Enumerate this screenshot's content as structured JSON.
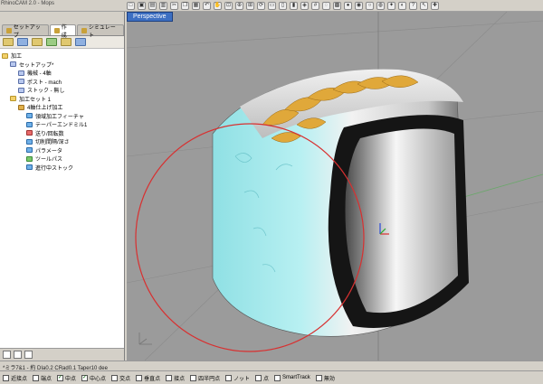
{
  "app": {
    "title": "RhinoCAM 2.0 - Mops"
  },
  "toolbar": {
    "buttons": [
      "new",
      "open",
      "save",
      "print",
      "cut",
      "copy",
      "paste",
      "undo",
      "hand",
      "zoom-window",
      "zoom",
      "zoom-extents",
      "rotate",
      "top",
      "front",
      "right",
      "perspective",
      "grid",
      "lasso",
      "select-all",
      "shaded",
      "render",
      "sphere",
      "globe",
      "light",
      "camera",
      "help",
      "arrow",
      "tools"
    ]
  },
  "panel": {
    "tabs": [
      {
        "label": "セットアップ",
        "icon": "setup-icon"
      },
      {
        "label": "作成",
        "icon": "create-icon"
      },
      {
        "label": "シミュレート",
        "icon": "simulate-icon"
      }
    ],
    "tree": [
      {
        "label": "加工",
        "icon": "folder",
        "indent": 0
      },
      {
        "label": "セットアップ*",
        "icon": "doc",
        "indent": 1
      },
      {
        "label": "機械 - 4軸",
        "icon": "doc",
        "indent": 2
      },
      {
        "label": "ポスト - mach",
        "icon": "doc",
        "indent": 2
      },
      {
        "label": "ストック - 無し",
        "icon": "doc",
        "indent": 2
      },
      {
        "label": "加工セット 1",
        "icon": "folder",
        "indent": 1
      },
      {
        "label": "4軸仕上げ加工",
        "icon": "drill",
        "indent": 2
      },
      {
        "label": "領域加工フィーチャ",
        "icon": "tool",
        "indent": 3
      },
      {
        "label": "テーパーエンドミル1",
        "icon": "tool",
        "indent": 3
      },
      {
        "label": "送り/回転数",
        "icon": "red",
        "indent": 3
      },
      {
        "label": "切削間隔/深さ",
        "icon": "tool",
        "indent": 3
      },
      {
        "label": "パラメータ",
        "icon": "tool",
        "indent": 3
      },
      {
        "label": "ツールパス",
        "icon": "green",
        "indent": 3
      },
      {
        "label": "進行中ストック",
        "icon": "tool",
        "indent": 3
      }
    ]
  },
  "viewport": {
    "tab_label": "Perspective"
  },
  "status": {
    "text": "*ミラ7&1 - 約 DIa0.2 CRad0.1 Taper10 dee"
  },
  "snaps": [
    {
      "label": "近接点",
      "checked": false
    },
    {
      "label": "端点",
      "checked": false
    },
    {
      "label": "中点",
      "checked": true
    },
    {
      "label": "中心点",
      "checked": true
    },
    {
      "label": "交点",
      "checked": false
    },
    {
      "label": "垂直点",
      "checked": false
    },
    {
      "label": "接点",
      "checked": false
    },
    {
      "label": "四半円点",
      "checked": false
    },
    {
      "label": "ノット",
      "checked": false
    },
    {
      "label": "点",
      "checked": false
    },
    {
      "label": "SmartTrack",
      "checked": false
    },
    {
      "label": "無効",
      "checked": false
    }
  ],
  "colors": {
    "viewport_bg": "#9b9b9b",
    "tab_blue": "#3d6fc2",
    "selection_cyan": "#8fe0e4",
    "gold": "#e0a83a",
    "circle_red": "#d83030"
  }
}
